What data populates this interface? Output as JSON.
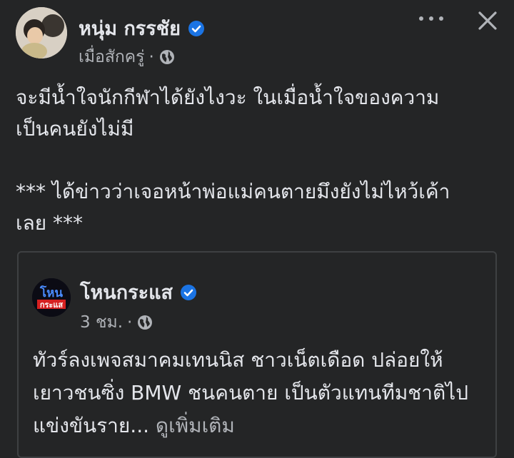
{
  "post": {
    "author": "หนุ่ม กรรชัย",
    "timestamp": "เมื่อสักครู่",
    "separator": "·",
    "privacy_icon": "globe-icon",
    "text": "จะมีน้ำใจนักกีฬาได้ยังไงวะ ในเมื่อน้ำใจของความ\nเป็นคนยังไม่มี\n\n*** ได้ข่าวว่าเจอหน้าพ่อแม่คนตายมึงยังไม่ไหว้เค้า\nเลย ***"
  },
  "shared": {
    "page_name": "โหนกระแส",
    "logo_text_top": "โหน",
    "logo_text_bottom": "กระแส",
    "timestamp": "3 ชม.",
    "separator": "·",
    "text": "ทัวร์ลงเพจสมาคมเทนนิส ชาวเน็ตเดือด ปล่อยให้เยาวชนซิ่ง BMW ชนคนตาย เป็นตัวแทนทีมชาติไปแข่งขันราย...",
    "see_more": "ดูเพิ่มเติม"
  },
  "colors": {
    "background": "#242526",
    "primary_text": "#e4e6eb",
    "secondary_text": "#b0b3b8",
    "verified_blue": "#1b74e4",
    "card_border": "#3e4042"
  }
}
